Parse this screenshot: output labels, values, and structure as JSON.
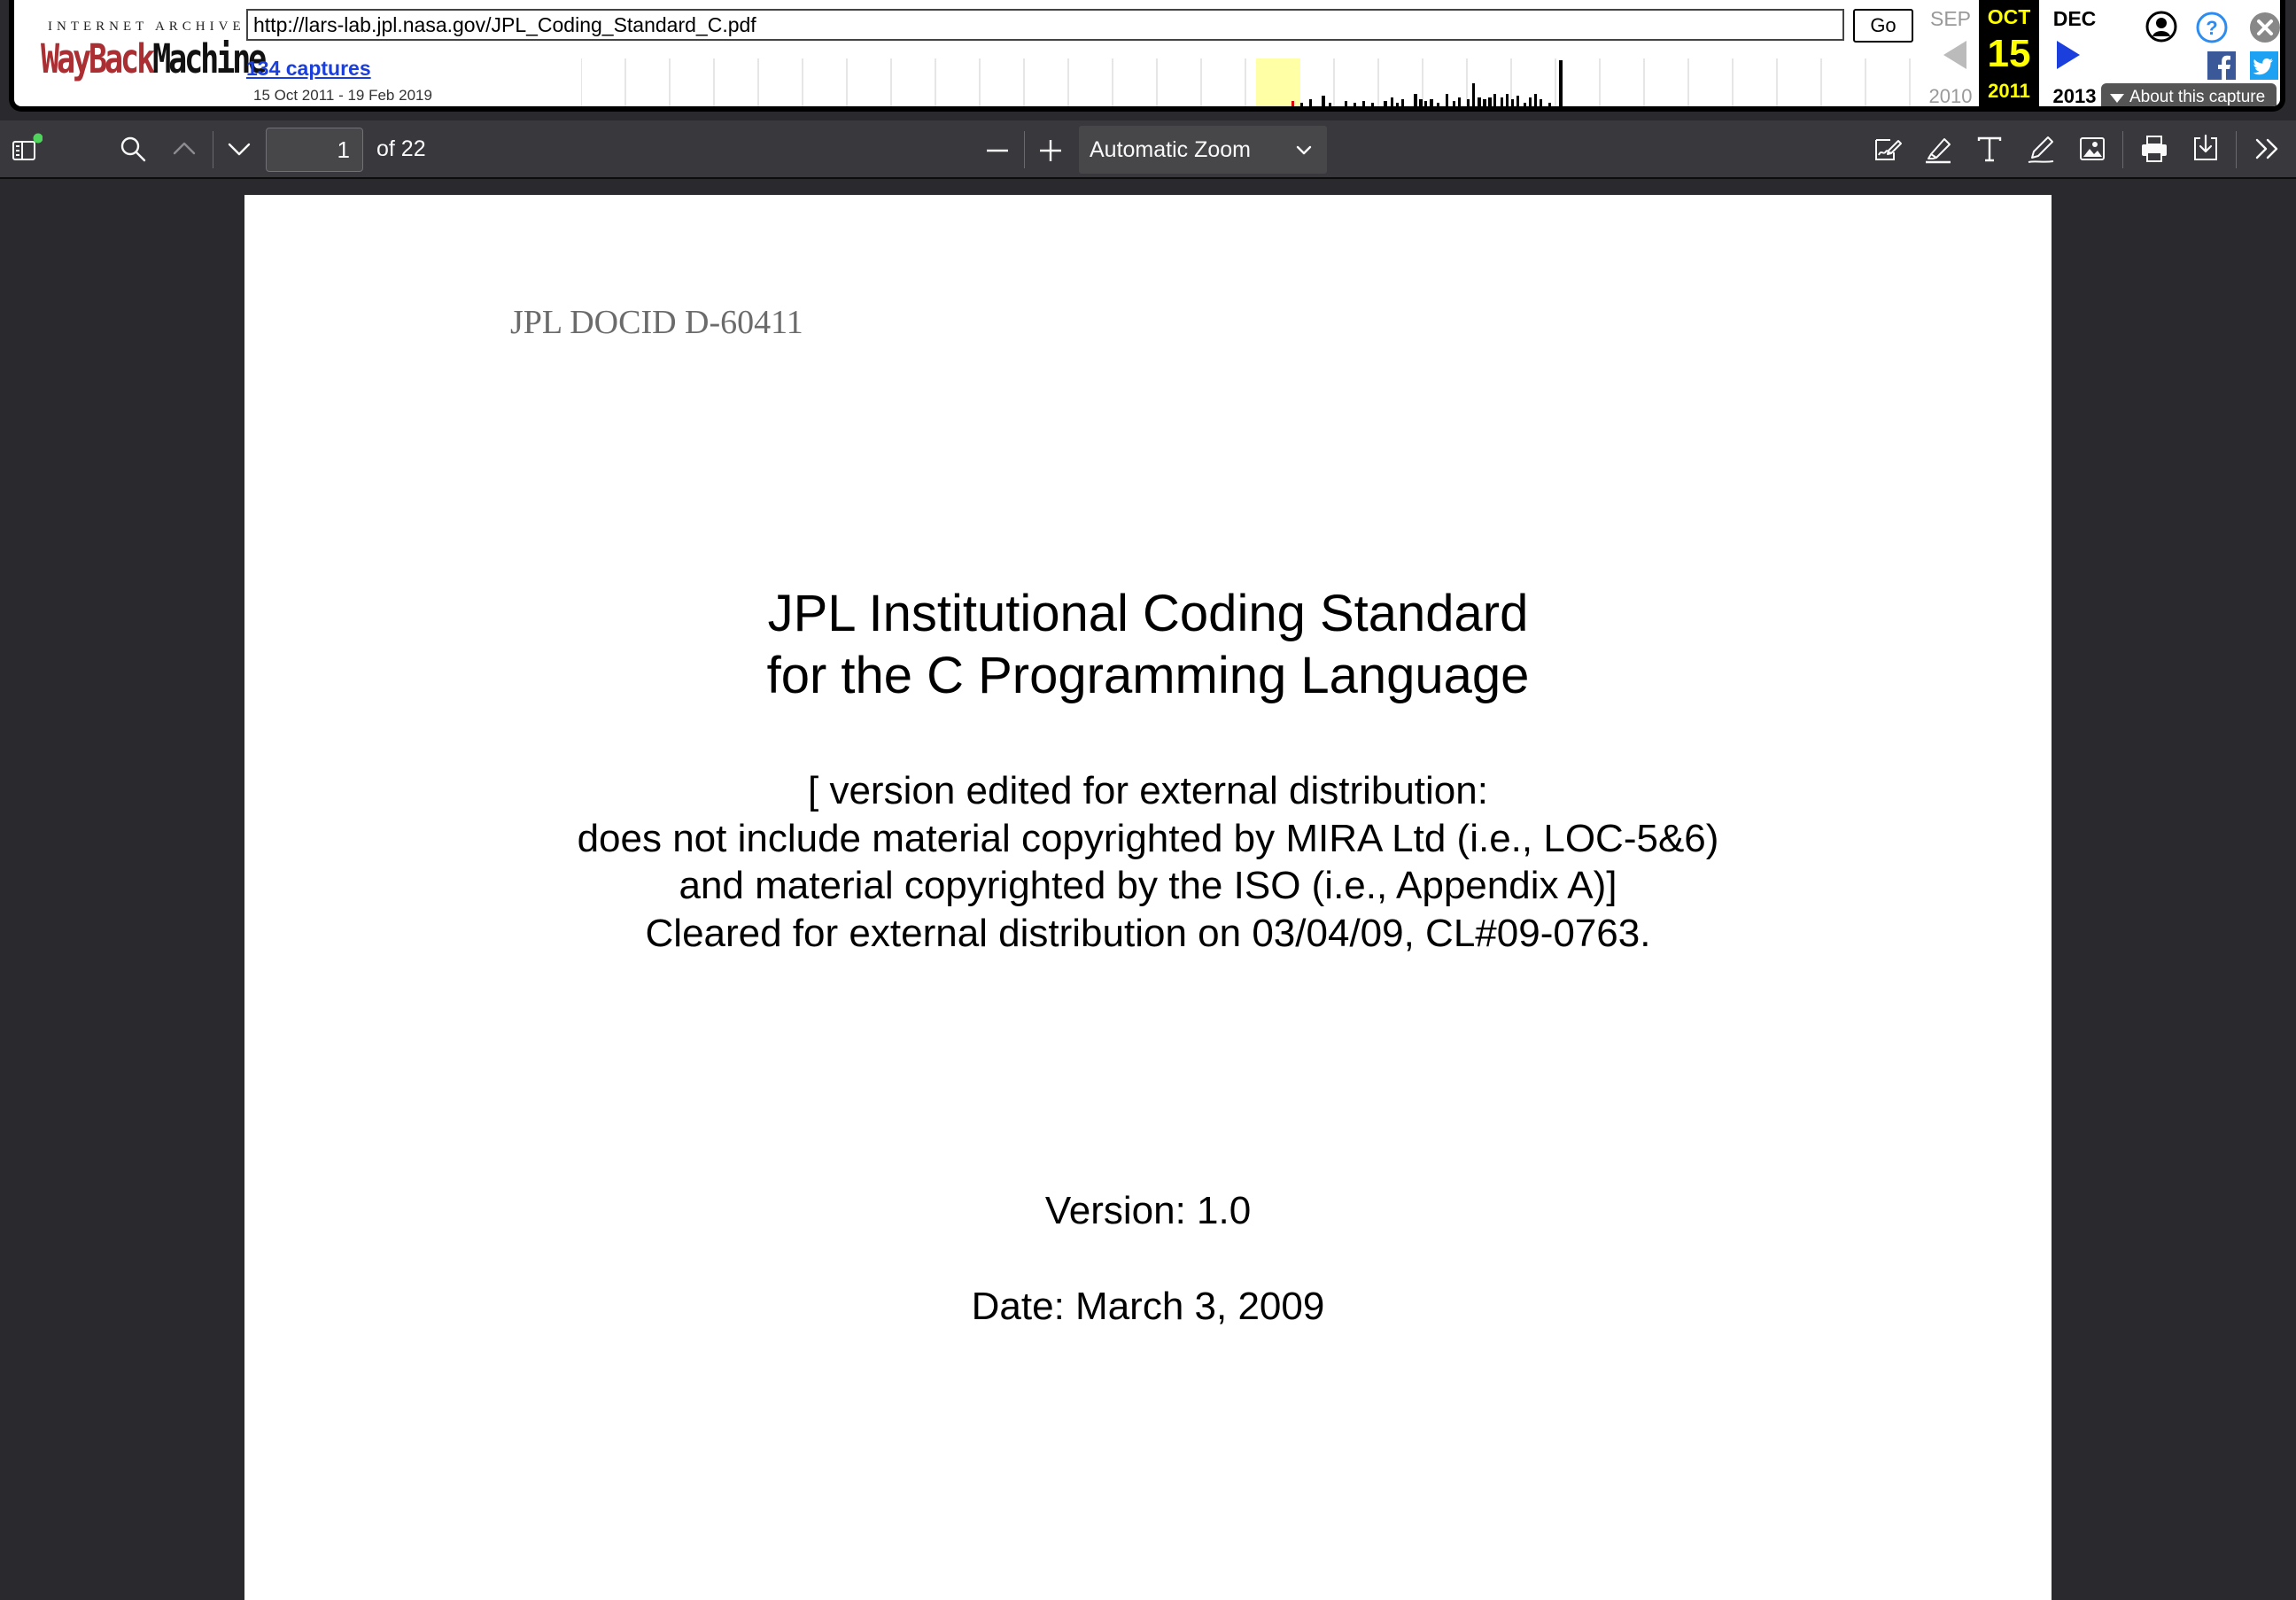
{
  "wayback": {
    "logo_top": "INTERNET ARCHIVE",
    "logo_way": "WayBack",
    "logo_machine": "Machine",
    "url": "http://lars-lab.jpl.nasa.gov/JPL_Coding_Standard_C.pdf",
    "go_label": "Go",
    "captures_link": "134 captures",
    "date_range": "15 Oct 2011 - 19 Feb 2019",
    "prev_month": "SEP",
    "current_month": "OCT",
    "current_day": "15",
    "current_year": "2011",
    "next_month": "DEC",
    "prev_year": "2010",
    "next_year": "2013",
    "about_label": "About this capture",
    "accent_color": "#1a3fdc",
    "highlight_color": "#ffff00"
  },
  "viewer": {
    "page_number": "1",
    "page_total": "of 22",
    "zoom_label": "Automatic Zoom",
    "icons": [
      "sidebar-toggle-icon",
      "search-icon",
      "chevron-up-icon",
      "chevron-down-icon",
      "minus-icon",
      "plus-icon",
      "signature-icon",
      "highlight-icon",
      "text-icon",
      "draw-icon",
      "image-icon",
      "print-icon",
      "download-icon",
      "tools-icon"
    ]
  },
  "document": {
    "doc_id": "JPL DOCID D-60411",
    "title_line1": "JPL Institutional Coding Standard",
    "title_line2": "for the C Programming Language",
    "note_line1": "[ version edited for external distribution:",
    "note_line2": "does not include material copyrighted by MIRA Ltd (i.e., LOC-5&6)",
    "note_line3": "and material copyrighted by the ISO (i.e., Appendix A)]",
    "note_line4": "Cleared for external distribution on 03/04/09, CL#09-0763.",
    "version": "Version: 1.0",
    "date": "Date: March 3, 2009"
  }
}
